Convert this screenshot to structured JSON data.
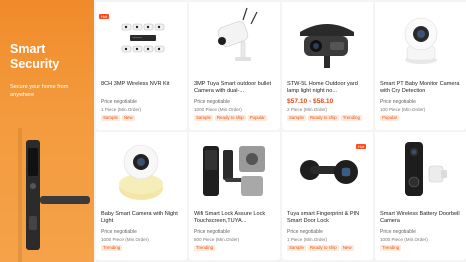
{
  "banner": {
    "title": "Smart Security",
    "subtitle": "Secure your home from anywhere"
  },
  "products": [
    {
      "name": "8CH 3MP Wireless NVR Kit",
      "price": "Price negotiable",
      "moq": "1 Piece (Min.Order)",
      "tags": [
        "Sample",
        "New"
      ],
      "badge": "Hot"
    },
    {
      "name": "3MP Tuya Smart outdoor bullet Camera with dual-...",
      "price": "Price negotiable",
      "moq": "1000 Piece (Min.Order)",
      "tags": [
        "Sample",
        "Ready to ship",
        "Popular"
      ]
    },
    {
      "name": "STW-5L Home Outdoor yard lamp light night no...",
      "price": "$57.10 - $58.10",
      "moq": "2 Piece (Min.Order)",
      "tags": [
        "Sample",
        "Ready to ship",
        "Trending"
      ]
    },
    {
      "name": "Smart PT Baby Monitor Camera with Cry Detection",
      "price": "Price negotiable",
      "moq": "100 Piece (Min.Order)",
      "tags": [
        "Popular"
      ]
    },
    {
      "name": "Baby Smart Camera with Night Light",
      "price": "Price negotiable",
      "moq": "1000 Piece (Min.Order)",
      "tags": [
        "Trending"
      ]
    },
    {
      "name": "Wifi Smart Lock Assure Lock Touchscreen,TUYA...",
      "price": "Price negotiable",
      "moq": "500 Piece (Min.Order)",
      "tags": [
        "Trending"
      ]
    },
    {
      "name": "Tuya smart Fingerprint & PIN Smart Door Lock",
      "price": "Price negotiable",
      "moq": "1 Piece (Min.Order)",
      "tags": [
        "Sample",
        "Ready to ship",
        "New"
      ],
      "badge": "Hot"
    },
    {
      "name": "Smart Wireless Battery Doorbell Camera",
      "price": "Price negotiable",
      "moq": "1000 Piece (Min.Order)",
      "tags": [
        "Trending"
      ]
    }
  ],
  "colors": {
    "banner_orange": "#f08a2a",
    "tag_text": "#e8530f",
    "price_red": "#e64a19"
  }
}
